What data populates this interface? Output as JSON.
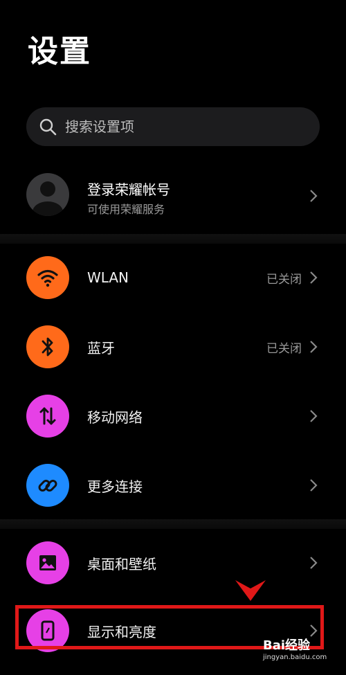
{
  "page_title": "设置",
  "search": {
    "placeholder": "搜索设置项"
  },
  "account": {
    "name": "登录荣耀帐号",
    "subtitle": "可使用荣耀服务"
  },
  "items": [
    {
      "label": "WLAN",
      "status": "已关闭",
      "icon": "wifi-icon",
      "color": "#ff6a1a"
    },
    {
      "label": "蓝牙",
      "status": "已关闭",
      "icon": "bluetooth-icon",
      "color": "#ff6a1a"
    },
    {
      "label": "移动网络",
      "status": "",
      "icon": "mobile-data-icon",
      "color": "#e640e6"
    },
    {
      "label": "更多连接",
      "status": "",
      "icon": "link-icon",
      "color": "#1e8bff"
    },
    {
      "label": "桌面和壁纸",
      "status": "",
      "icon": "wallpaper-icon",
      "color": "#e640e6"
    },
    {
      "label": "显示和亮度",
      "status": "",
      "icon": "display-icon",
      "color": "#e640e6"
    }
  ],
  "watermark": {
    "brand": "Bai经验",
    "url": "jingyan.baidu.com"
  },
  "colors": {
    "highlight": "#e01818",
    "background": "#000000"
  }
}
